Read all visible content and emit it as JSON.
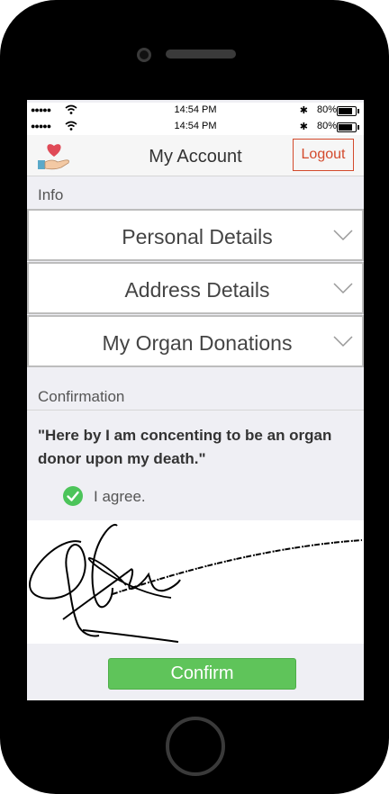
{
  "status_bar": {
    "time": "14:54 PM",
    "battery": "80%"
  },
  "header": {
    "title": "My Account",
    "logout_label": "Logout"
  },
  "info": {
    "section_label": "Info",
    "items": [
      {
        "label": "Personal Details"
      },
      {
        "label": "Address Details"
      },
      {
        "label": "My Organ Donations"
      }
    ]
  },
  "confirmation": {
    "section_label": "Confirmation",
    "statement": "\"Here by I am concenting to be an organ donor upon my death.\"",
    "agree_label": "I agree.",
    "agreed": true
  },
  "actions": {
    "confirm_label": "Confirm"
  },
  "colors": {
    "accent": "#d34a2c",
    "confirm": "#5fc45a",
    "check": "#4cc45a"
  }
}
